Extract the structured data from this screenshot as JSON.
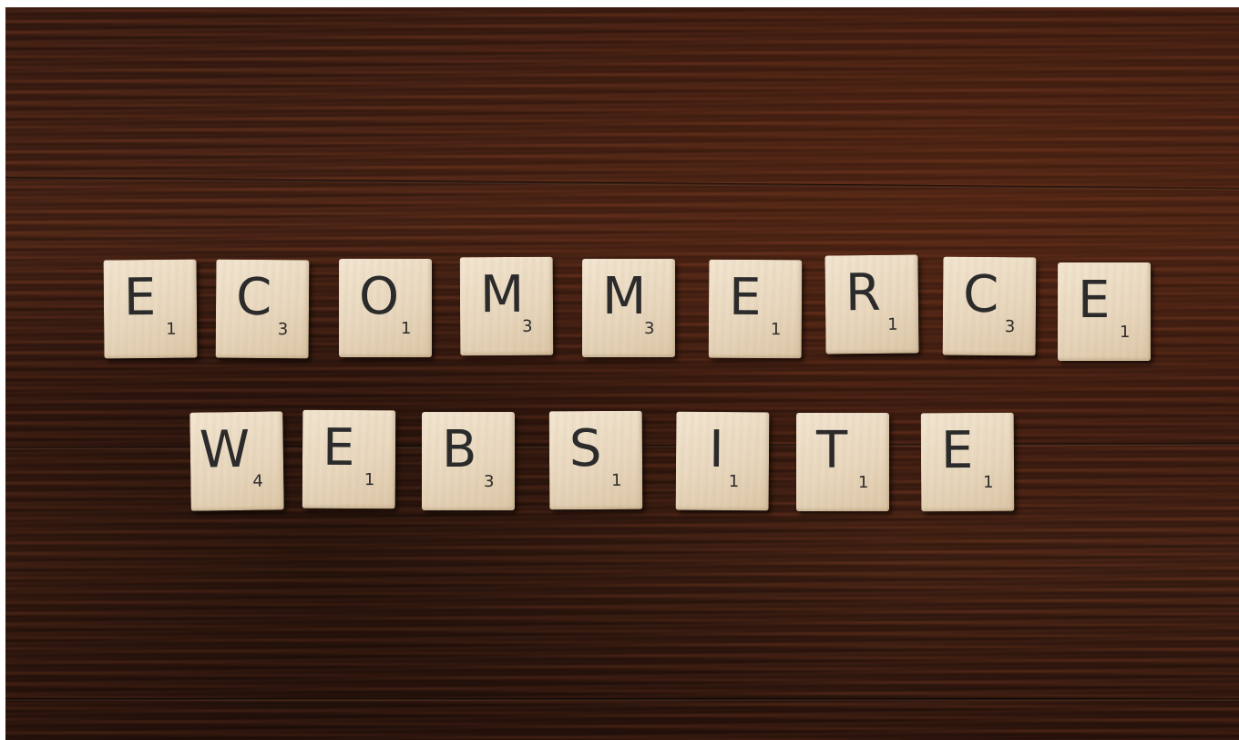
{
  "scene": {
    "description_words": [
      "ECOMMERCE",
      "WEBSITE"
    ],
    "colors": {
      "wood": "#4a2416",
      "tile": "#ebdac2",
      "ink": "#2b2b2b"
    }
  },
  "row1": [
    {
      "letter": "E",
      "score": "1"
    },
    {
      "letter": "C",
      "score": "3"
    },
    {
      "letter": "O",
      "score": "1"
    },
    {
      "letter": "M",
      "score": "3"
    },
    {
      "letter": "M",
      "score": "3"
    },
    {
      "letter": "E",
      "score": "1"
    },
    {
      "letter": "R",
      "score": "1"
    },
    {
      "letter": "C",
      "score": "3"
    },
    {
      "letter": "E",
      "score": "1"
    }
  ],
  "row2": [
    {
      "letter": "W",
      "score": "4"
    },
    {
      "letter": "E",
      "score": "1"
    },
    {
      "letter": "B",
      "score": "3"
    },
    {
      "letter": "S",
      "score": "1"
    },
    {
      "letter": "I",
      "score": "1"
    },
    {
      "letter": "T",
      "score": "1"
    },
    {
      "letter": "E",
      "score": "1"
    }
  ]
}
